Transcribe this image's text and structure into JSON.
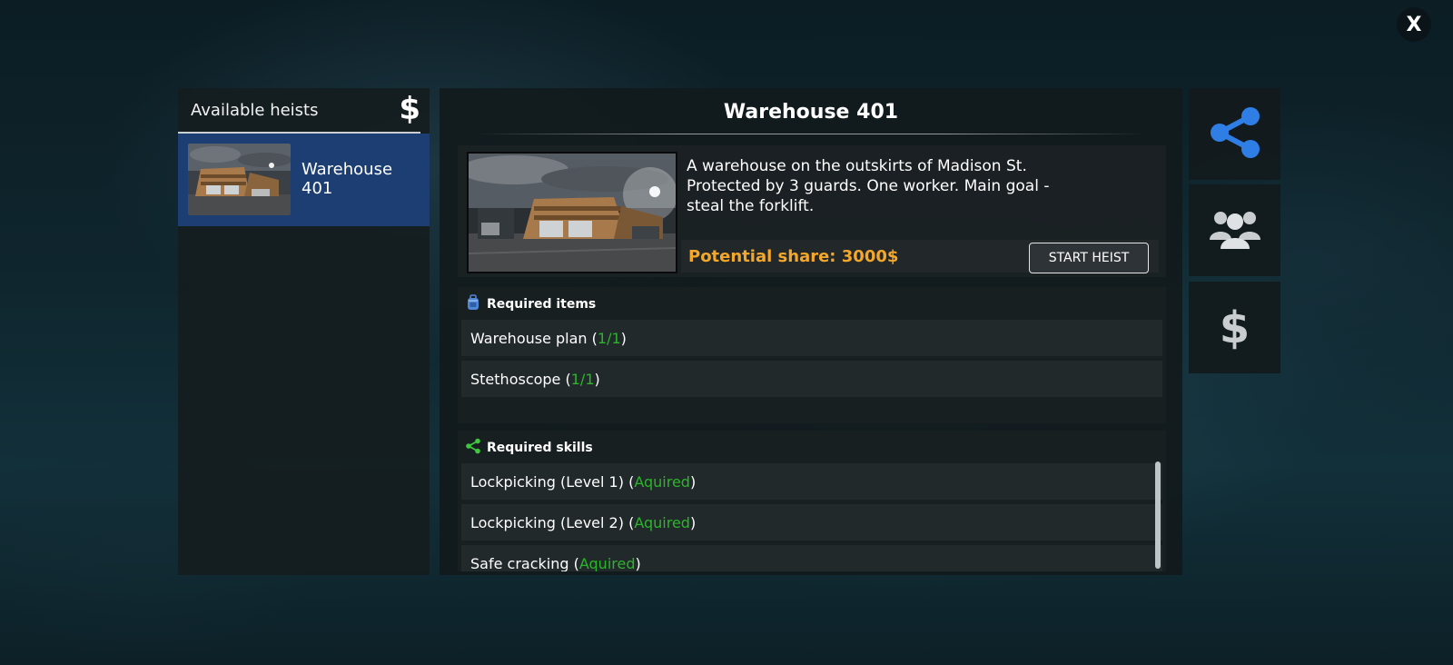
{
  "close": {
    "label": "X"
  },
  "heists_panel": {
    "title": "Available heists",
    "currency_symbol": "$",
    "items": [
      {
        "name": "Warehouse 401"
      }
    ]
  },
  "detail": {
    "title": "Warehouse 401",
    "description": "A warehouse on the outskirts of Madison St. Protected by 3 guards. One worker. Main goal - steal the forklift.",
    "potential_share": "Potential share: 3000$",
    "start_button": "START HEIST"
  },
  "required_items": {
    "title": "Required items",
    "rows": [
      {
        "name": "Warehouse plan",
        "open": "(",
        "count": "1/1",
        "close": ")"
      },
      {
        "name": "Stethoscope",
        "open": "(",
        "count": "1/1",
        "close": ")"
      }
    ]
  },
  "required_skills": {
    "title": "Required skills",
    "rows": [
      {
        "name": "Lockpicking (Level 1)",
        "open": "(",
        "status": "Aquired",
        "close": ")"
      },
      {
        "name": "Lockpicking (Level 2)",
        "open": "(",
        "status": "Aquired",
        "close": ")"
      },
      {
        "name": "Safe cracking",
        "open": "(",
        "status": "Aquired",
        "close": ")"
      }
    ]
  },
  "side_buttons": {
    "skills": "share-network-icon",
    "crew": "users-group-icon",
    "money": "dollar-icon",
    "currency_symbol": "$"
  },
  "colors": {
    "accent_blue": "#2f7ee6",
    "selected_item": "#1d3e72",
    "share_orange": "#f3a82b",
    "status_green": "#2bb52b"
  }
}
